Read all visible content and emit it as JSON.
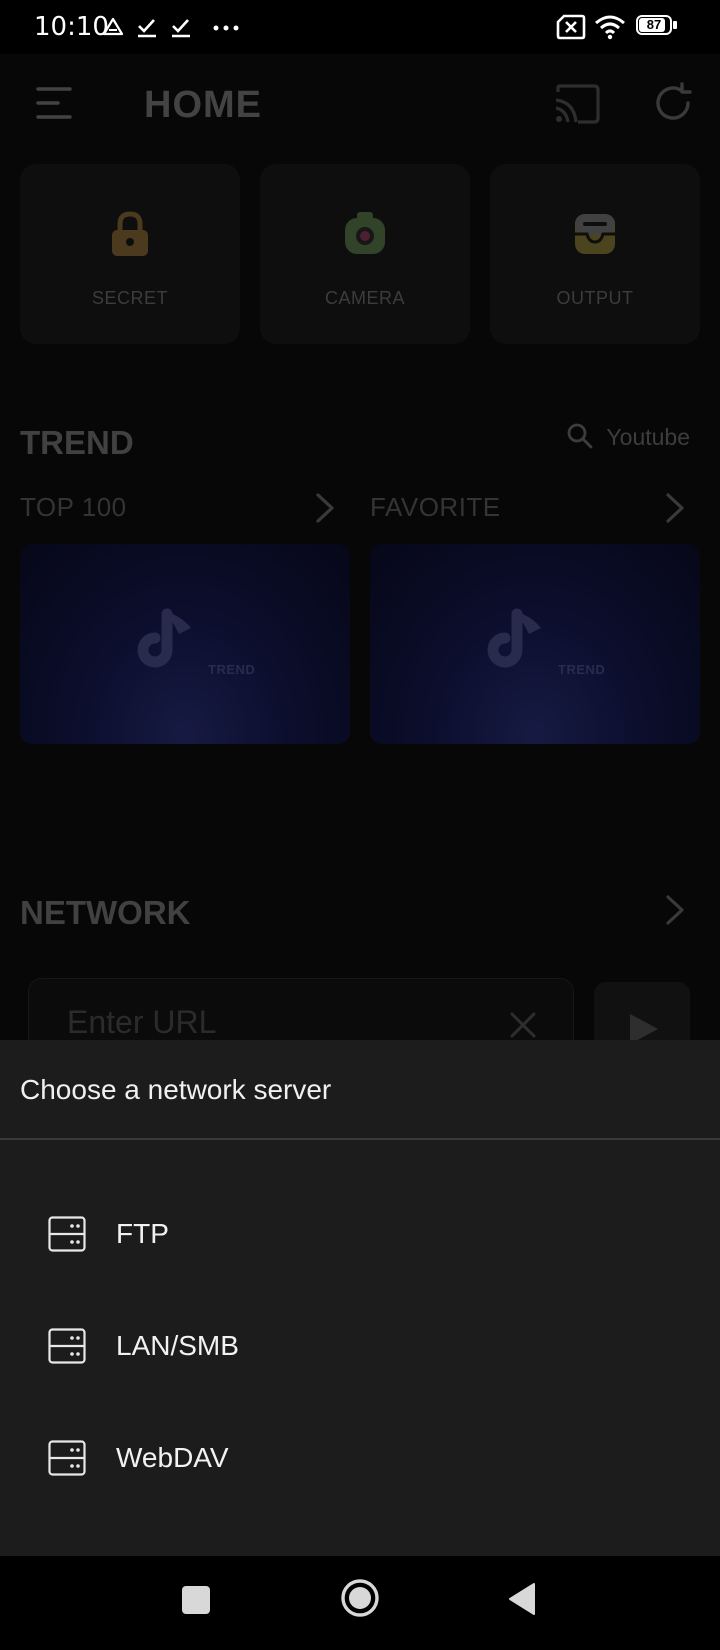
{
  "status_bar": {
    "time": "10:10",
    "battery_level": "87",
    "icons": [
      "drive-icon",
      "check-icon",
      "check-icon",
      "more-dots-icon",
      "sim-off-icon",
      "wifi-icon",
      "battery-icon"
    ]
  },
  "header": {
    "title": "HOME",
    "icons": [
      "menu-icon",
      "cast-icon",
      "refresh-icon"
    ]
  },
  "tiles": [
    {
      "label": "SECRET",
      "icon": "lock-icon",
      "color": "#8a6a3a"
    },
    {
      "label": "CAMERA",
      "icon": "camera-icon",
      "color": "#5a7a4a"
    },
    {
      "label": "OUTPUT",
      "icon": "inbox-icon",
      "color": "#8a7a3a"
    }
  ],
  "trend": {
    "title": "TREND",
    "search_label": "Youtube",
    "top100_label": "TOP 100",
    "favorite_label": "FAVORITE",
    "thumb_logo_text": "TREND"
  },
  "network": {
    "title": "NETWORK",
    "url_placeholder": "Enter URL"
  },
  "sheet": {
    "title": "Choose a network server",
    "items": [
      {
        "label": "FTP",
        "icon": "server-icon"
      },
      {
        "label": "LAN/SMB",
        "icon": "server-icon"
      },
      {
        "label": "WebDAV",
        "icon": "server-icon"
      }
    ]
  },
  "nav_bar": {
    "buttons": [
      "recents-button",
      "home-button",
      "back-button"
    ]
  }
}
